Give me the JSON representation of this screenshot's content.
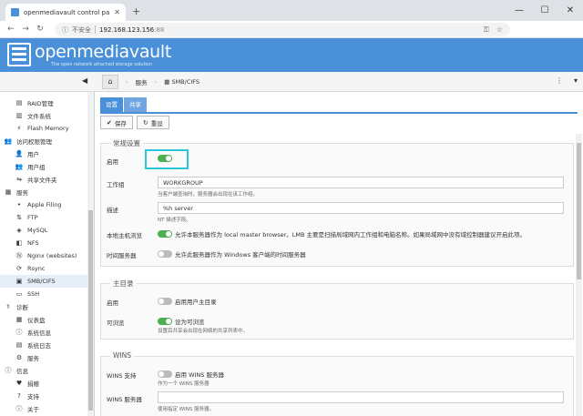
{
  "browser": {
    "tab_title": "openmediavault control panel",
    "insecure_label": "不安全",
    "url_host": "192.168.123.156",
    "url_port": ":88"
  },
  "header": {
    "brand": "openmediavault",
    "tagline": "The open network attached storage solution"
  },
  "breadcrumb": {
    "section": "服务",
    "page": "SMB/CIFS"
  },
  "sidebar": {
    "items": [
      {
        "label": "RAID管理",
        "icon": "raid-icon",
        "level": 1
      },
      {
        "label": "文件系统",
        "icon": "filesystem-icon",
        "level": 1
      },
      {
        "label": "Flash Memory",
        "icon": "flash-icon",
        "level": 1
      },
      {
        "label": "访问权限管理",
        "icon": "access-icon",
        "level": 0
      },
      {
        "label": "用户",
        "icon": "user-icon",
        "level": 1
      },
      {
        "label": "用户组",
        "icon": "group-icon",
        "level": 1
      },
      {
        "label": "共享文件夹",
        "icon": "share-icon",
        "level": 1
      },
      {
        "label": "服务",
        "icon": "services-icon",
        "level": 0
      },
      {
        "label": "Apple Filing",
        "icon": "apple-icon",
        "level": 1
      },
      {
        "label": "FTP",
        "icon": "ftp-icon",
        "level": 1
      },
      {
        "label": "MySQL",
        "icon": "mysql-icon",
        "level": 1
      },
      {
        "label": "NFS",
        "icon": "nfs-icon",
        "level": 1
      },
      {
        "label": "Nginx (websites)",
        "icon": "nginx-icon",
        "level": 1
      },
      {
        "label": "Rsync",
        "icon": "rsync-icon",
        "level": 1
      },
      {
        "label": "SMB/CIFS",
        "icon": "smb-icon",
        "level": 1,
        "selected": true
      },
      {
        "label": "SSH",
        "icon": "ssh-icon",
        "level": 1
      },
      {
        "label": "诊断",
        "icon": "diagnostics-icon",
        "level": 0
      },
      {
        "label": "仪表盘",
        "icon": "dashboard-icon",
        "level": 1
      },
      {
        "label": "系统信息",
        "icon": "info-icon",
        "level": 1
      },
      {
        "label": "系统日志",
        "icon": "log-icon",
        "level": 1
      },
      {
        "label": "服务",
        "icon": "service-status-icon",
        "level": 1
      },
      {
        "label": "信息",
        "icon": "information-icon",
        "level": 0
      },
      {
        "label": "捐赠",
        "icon": "heart-icon",
        "level": 1
      },
      {
        "label": "支持",
        "icon": "support-icon",
        "level": 1
      },
      {
        "label": "关于",
        "icon": "about-icon",
        "level": 1
      }
    ]
  },
  "tabs": {
    "settings": "设置",
    "shares": "共享"
  },
  "toolbar": {
    "save": "保存",
    "reset": "重设"
  },
  "general": {
    "legend": "常规设置",
    "enable_label": "启用",
    "enable_on": true,
    "workgroup_label": "工作组",
    "workgroup_value": "WORKGROUP",
    "workgroup_hint": "当客户端查询时，服务器会出现在该工作组。",
    "desc_label": "描述",
    "desc_value": "%h server",
    "desc_hint": "NT 描述字段。",
    "local_master_label": "本地主机浏览",
    "local_master_on": true,
    "local_master_text": "允许本服务器作为 local master browser。LMB 主要是扫描局域网内工作组和电脑名称。如果局域网中没有域控制器建议开启此项。",
    "time_server_label": "时间服务器",
    "time_server_on": false,
    "time_server_text": "允许此服务器作为 Windows 客户端的时间服务器"
  },
  "homes": {
    "legend": "主目录",
    "enable_label": "启用",
    "enable_on": false,
    "enable_text": "启用用户主目录",
    "browse_label": "可浏览",
    "browse_on": true,
    "browse_text": "设为可浏览",
    "browse_hint": "设置后共享会出现在网络的共享列表中。"
  },
  "wins": {
    "legend": "WINS",
    "support_label": "WINS 支持",
    "support_on": false,
    "support_text": "启用 WINS 服务器",
    "support_hint": "作为一个 WINS 服务器",
    "server_label": "WINS 服务器",
    "server_value": "",
    "server_hint": "使用指定 WINS 服务器。"
  }
}
